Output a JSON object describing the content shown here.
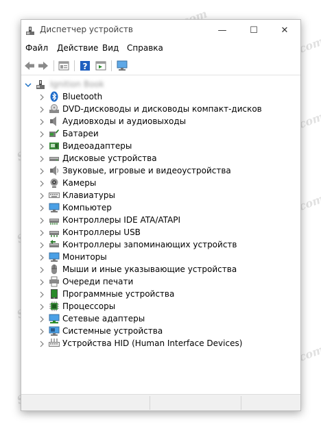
{
  "window": {
    "title": "Диспетчер устройств",
    "controls": {
      "minimize": "—",
      "maximize": "☐",
      "close": "✕"
    }
  },
  "menu": {
    "file": "Файл",
    "action": "Действие",
    "view": "Вид",
    "help": "Справка"
  },
  "toolbar": {
    "buttons": [
      "back-arrow-icon",
      "forward-arrow-icon",
      "properties-icon",
      "help-icon",
      "show-hidden-icon",
      "monitor-scan-icon"
    ]
  },
  "tree": {
    "root_label": "Ignition Book",
    "categories": [
      {
        "label": "Bluetooth",
        "icon": "bluetooth-icon"
      },
      {
        "label": "DVD-дисководы и дисководы компакт-дисков",
        "icon": "dvd-drive-icon"
      },
      {
        "label": "Аудиовходы и аудиовыходы",
        "icon": "speaker-icon"
      },
      {
        "label": "Батареи",
        "icon": "battery-icon"
      },
      {
        "label": "Видеоадаптеры",
        "icon": "display-adapter-icon"
      },
      {
        "label": "Дисковые устройства",
        "icon": "disk-drive-icon"
      },
      {
        "label": "Звуковые, игровые и видеоустройства",
        "icon": "sound-device-icon"
      },
      {
        "label": "Камеры",
        "icon": "camera-icon"
      },
      {
        "label": "Клавиатуры",
        "icon": "keyboard-icon"
      },
      {
        "label": "Компьютер",
        "icon": "computer-icon"
      },
      {
        "label": "Контроллеры IDE ATA/ATAPI",
        "icon": "ide-controller-icon"
      },
      {
        "label": "Контроллеры USB",
        "icon": "usb-controller-icon"
      },
      {
        "label": "Контроллеры запоминающих устройств",
        "icon": "storage-controller-icon"
      },
      {
        "label": "Мониторы",
        "icon": "monitor-icon"
      },
      {
        "label": "Мыши и иные указывающие устройства",
        "icon": "mouse-icon"
      },
      {
        "label": "Очереди печати",
        "icon": "printer-icon"
      },
      {
        "label": "Программные устройства",
        "icon": "software-device-icon"
      },
      {
        "label": "Процессоры",
        "icon": "processor-icon"
      },
      {
        "label": "Сетевые адаптеры",
        "icon": "network-adapter-icon"
      },
      {
        "label": "Системные устройства",
        "icon": "system-device-icon"
      },
      {
        "label": "Устройства HID (Human Interface Devices)",
        "icon": "hid-device-icon"
      }
    ]
  },
  "watermark": "Soringpcrepair.com",
  "colors": {
    "expand_arrow": "#1a6fc4",
    "chevron": "#7a7a7a",
    "toolbar_blue": "#1f5fbf",
    "bluetooth_blue": "#1b6ac9"
  }
}
